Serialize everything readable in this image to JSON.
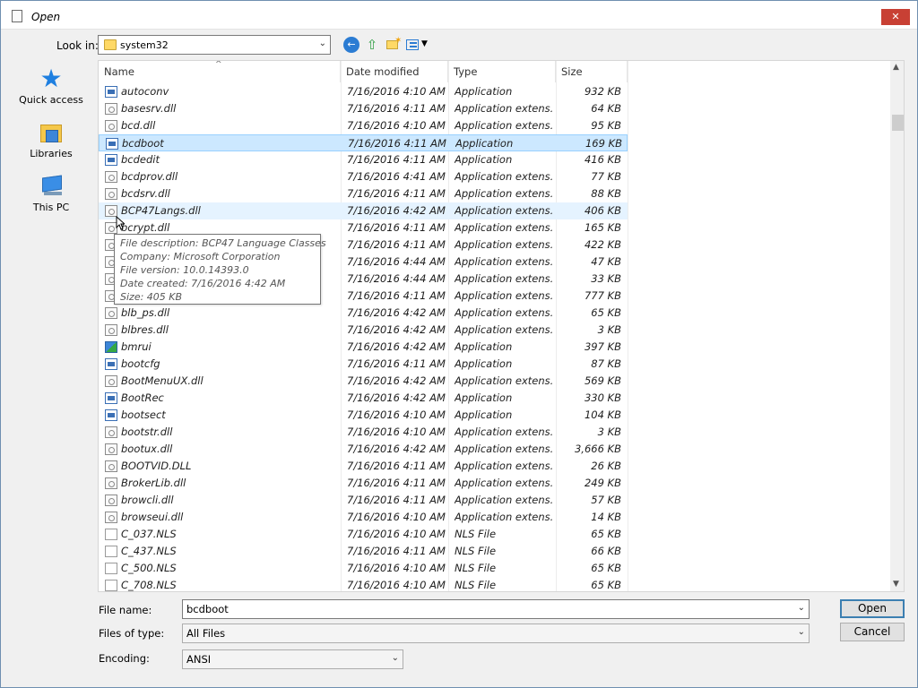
{
  "window": {
    "title": "Open",
    "close_label": "✕"
  },
  "lookin": {
    "label": "Look in:",
    "value": "system32"
  },
  "places": [
    {
      "label": "Quick access",
      "icon": "star-icon"
    },
    {
      "label": "Libraries",
      "icon": "libraries-icon"
    },
    {
      "label": "This PC",
      "icon": "computer-icon"
    }
  ],
  "columns": {
    "name": "Name",
    "date": "Date modified",
    "type": "Type",
    "size": "Size"
  },
  "files": [
    {
      "name": "autoconv",
      "date": "7/16/2016 4:10 AM",
      "type": "Application",
      "size": "932 KB",
      "icon": "app"
    },
    {
      "name": "basesrv.dll",
      "date": "7/16/2016 4:11 AM",
      "type": "Application extens...",
      "size": "64 KB",
      "icon": "dll"
    },
    {
      "name": "bcd.dll",
      "date": "7/16/2016 4:10 AM",
      "type": "Application extens...",
      "size": "95 KB",
      "icon": "dll"
    },
    {
      "name": "bcdboot",
      "date": "7/16/2016 4:11 AM",
      "type": "Application",
      "size": "169 KB",
      "icon": "app"
    },
    {
      "name": "bcdedit",
      "date": "7/16/2016 4:11 AM",
      "type": "Application",
      "size": "416 KB",
      "icon": "app"
    },
    {
      "name": "bcdprov.dll",
      "date": "7/16/2016 4:41 AM",
      "type": "Application extens...",
      "size": "77 KB",
      "icon": "dll"
    },
    {
      "name": "bcdsrv.dll",
      "date": "7/16/2016 4:11 AM",
      "type": "Application extens...",
      "size": "88 KB",
      "icon": "dll"
    },
    {
      "name": "BCP47Langs.dll",
      "date": "7/16/2016 4:42 AM",
      "type": "Application extens...",
      "size": "406 KB",
      "icon": "dll"
    },
    {
      "name": "bcrypt.dll",
      "date": "7/16/2016 4:11 AM",
      "type": "Application extens...",
      "size": "165 KB",
      "icon": "dll"
    },
    {
      "name": "",
      "date": "7/16/2016 4:11 AM",
      "type": "Application extens...",
      "size": "422 KB",
      "icon": "dll"
    },
    {
      "name": "",
      "date": "7/16/2016 4:44 AM",
      "type": "Application extens...",
      "size": "47 KB",
      "icon": "dll"
    },
    {
      "name": "",
      "date": "7/16/2016 4:44 AM",
      "type": "Application extens...",
      "size": "33 KB",
      "icon": "dll"
    },
    {
      "name": "",
      "date": "7/16/2016 4:11 AM",
      "type": "Application extens...",
      "size": "777 KB",
      "icon": "dll"
    },
    {
      "name": "blb_ps.dll",
      "date": "7/16/2016 4:42 AM",
      "type": "Application extens...",
      "size": "65 KB",
      "icon": "dll"
    },
    {
      "name": "blbres.dll",
      "date": "7/16/2016 4:42 AM",
      "type": "Application extens...",
      "size": "3 KB",
      "icon": "dll"
    },
    {
      "name": "bmrui",
      "date": "7/16/2016 4:42 AM",
      "type": "Application",
      "size": "397 KB",
      "icon": "special"
    },
    {
      "name": "bootcfg",
      "date": "7/16/2016 4:11 AM",
      "type": "Application",
      "size": "87 KB",
      "icon": "app"
    },
    {
      "name": "BootMenuUX.dll",
      "date": "7/16/2016 4:42 AM",
      "type": "Application extens...",
      "size": "569 KB",
      "icon": "dll"
    },
    {
      "name": "BootRec",
      "date": "7/16/2016 4:42 AM",
      "type": "Application",
      "size": "330 KB",
      "icon": "app"
    },
    {
      "name": "bootsect",
      "date": "7/16/2016 4:10 AM",
      "type": "Application",
      "size": "104 KB",
      "icon": "app"
    },
    {
      "name": "bootstr.dll",
      "date": "7/16/2016 4:10 AM",
      "type": "Application extens...",
      "size": "3 KB",
      "icon": "dll"
    },
    {
      "name": "bootux.dll",
      "date": "7/16/2016 4:42 AM",
      "type": "Application extens...",
      "size": "3,666 KB",
      "icon": "dll"
    },
    {
      "name": "BOOTVID.DLL",
      "date": "7/16/2016 4:11 AM",
      "type": "Application extens...",
      "size": "26 KB",
      "icon": "dll"
    },
    {
      "name": "BrokerLib.dll",
      "date": "7/16/2016 4:11 AM",
      "type": "Application extens...",
      "size": "249 KB",
      "icon": "dll"
    },
    {
      "name": "browcli.dll",
      "date": "7/16/2016 4:11 AM",
      "type": "Application extens...",
      "size": "57 KB",
      "icon": "dll"
    },
    {
      "name": "browseui.dll",
      "date": "7/16/2016 4:10 AM",
      "type": "Application extens...",
      "size": "14 KB",
      "icon": "dll"
    },
    {
      "name": "C_037.NLS",
      "date": "7/16/2016 4:10 AM",
      "type": "NLS File",
      "size": "65 KB",
      "icon": "nls"
    },
    {
      "name": "C_437.NLS",
      "date": "7/16/2016 4:11 AM",
      "type": "NLS File",
      "size": "66 KB",
      "icon": "nls"
    },
    {
      "name": "C_500.NLS",
      "date": "7/16/2016 4:10 AM",
      "type": "NLS File",
      "size": "65 KB",
      "icon": "nls"
    },
    {
      "name": "C_708.NLS",
      "date": "7/16/2016 4:10 AM",
      "type": "NLS File",
      "size": "65 KB",
      "icon": "nls"
    }
  ],
  "selected_index": 3,
  "hover_index": 7,
  "tooltip": [
    "File description: BCP47 Language Classes",
    "Company: Microsoft Corporation",
    "File version: 10.0.14393.0",
    "Date created: 7/16/2016 4:42 AM",
    "Size: 405 KB"
  ],
  "form": {
    "filename_label": "File name:",
    "filename_value": "bcdboot",
    "filetype_label": "Files of type:",
    "filetype_value": "All Files",
    "encoding_label": "Encoding:",
    "encoding_value": "ANSI",
    "open_label": "Open",
    "cancel_label": "Cancel"
  },
  "colors": {
    "selection": "#cce8ff",
    "hover": "#e5f3ff",
    "accent": "#2b7cd3"
  }
}
